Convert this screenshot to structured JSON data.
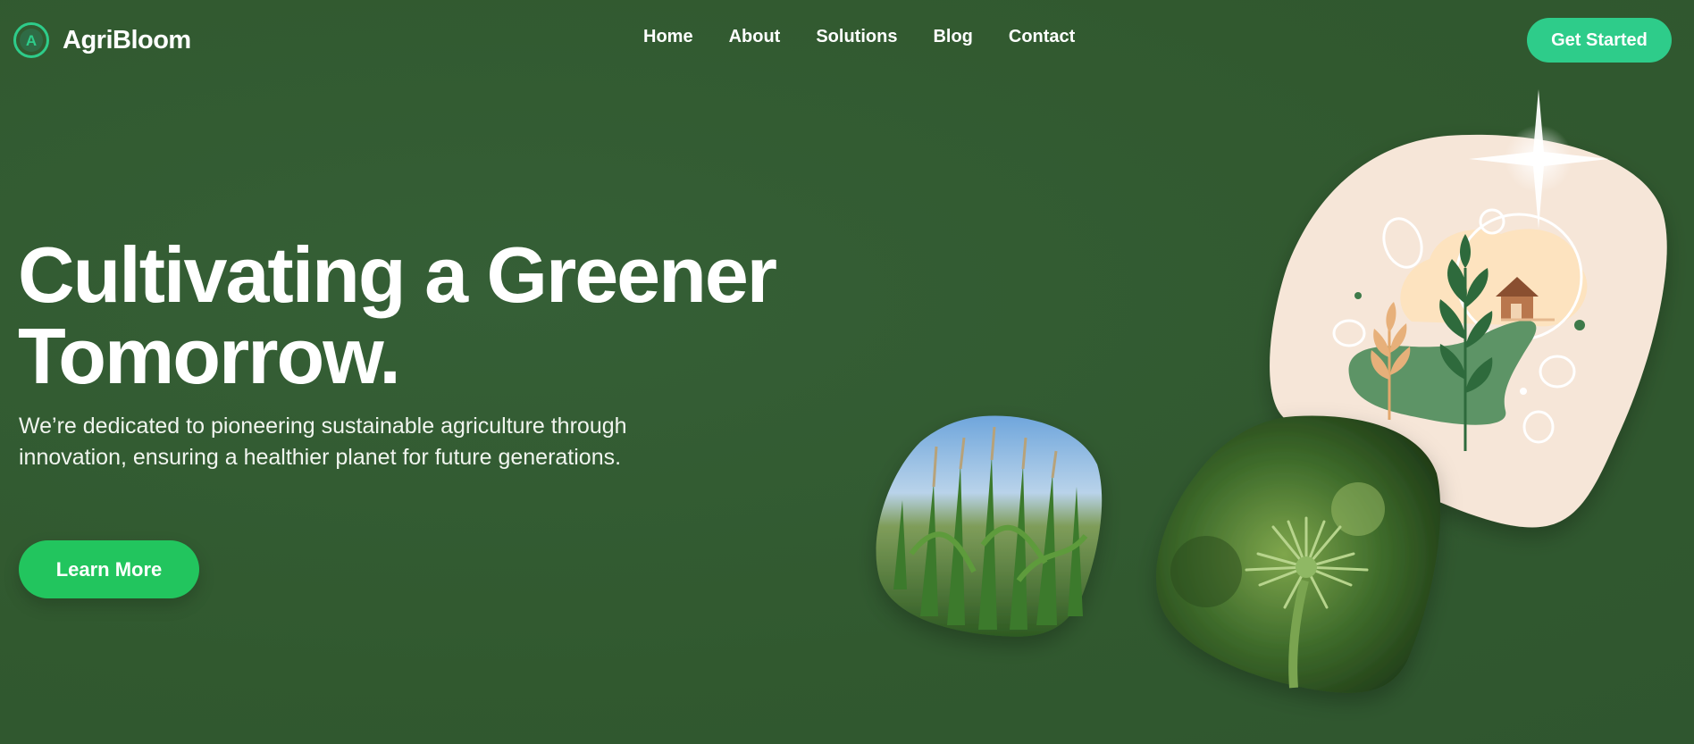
{
  "brand": {
    "name": "AgriBloom",
    "logo_letter": "A",
    "accent": "#2ecc8a"
  },
  "nav": [
    {
      "label": "Home"
    },
    {
      "label": "About"
    },
    {
      "label": "Solutions"
    },
    {
      "label": "Blog"
    },
    {
      "label": "Contact"
    }
  ],
  "header": {
    "cta_label": "Get Started"
  },
  "hero": {
    "title_line1": "Cultivating a Greener",
    "title_line2": "Tomorrow.",
    "subtitle": "We’re dedicated to pioneering sustainable agriculture through innovation, ensuring a healthier planet for future generations.",
    "button_label": "Learn More",
    "button_color": "#22c55e"
  },
  "colors": {
    "background": "#325a33",
    "blob_cream": "#f6e6d8",
    "accent": "#2ecc8a"
  },
  "images": [
    {
      "name": "cornfield-photo"
    },
    {
      "name": "plant-closeup-photo"
    },
    {
      "name": "farm-illustration"
    }
  ]
}
